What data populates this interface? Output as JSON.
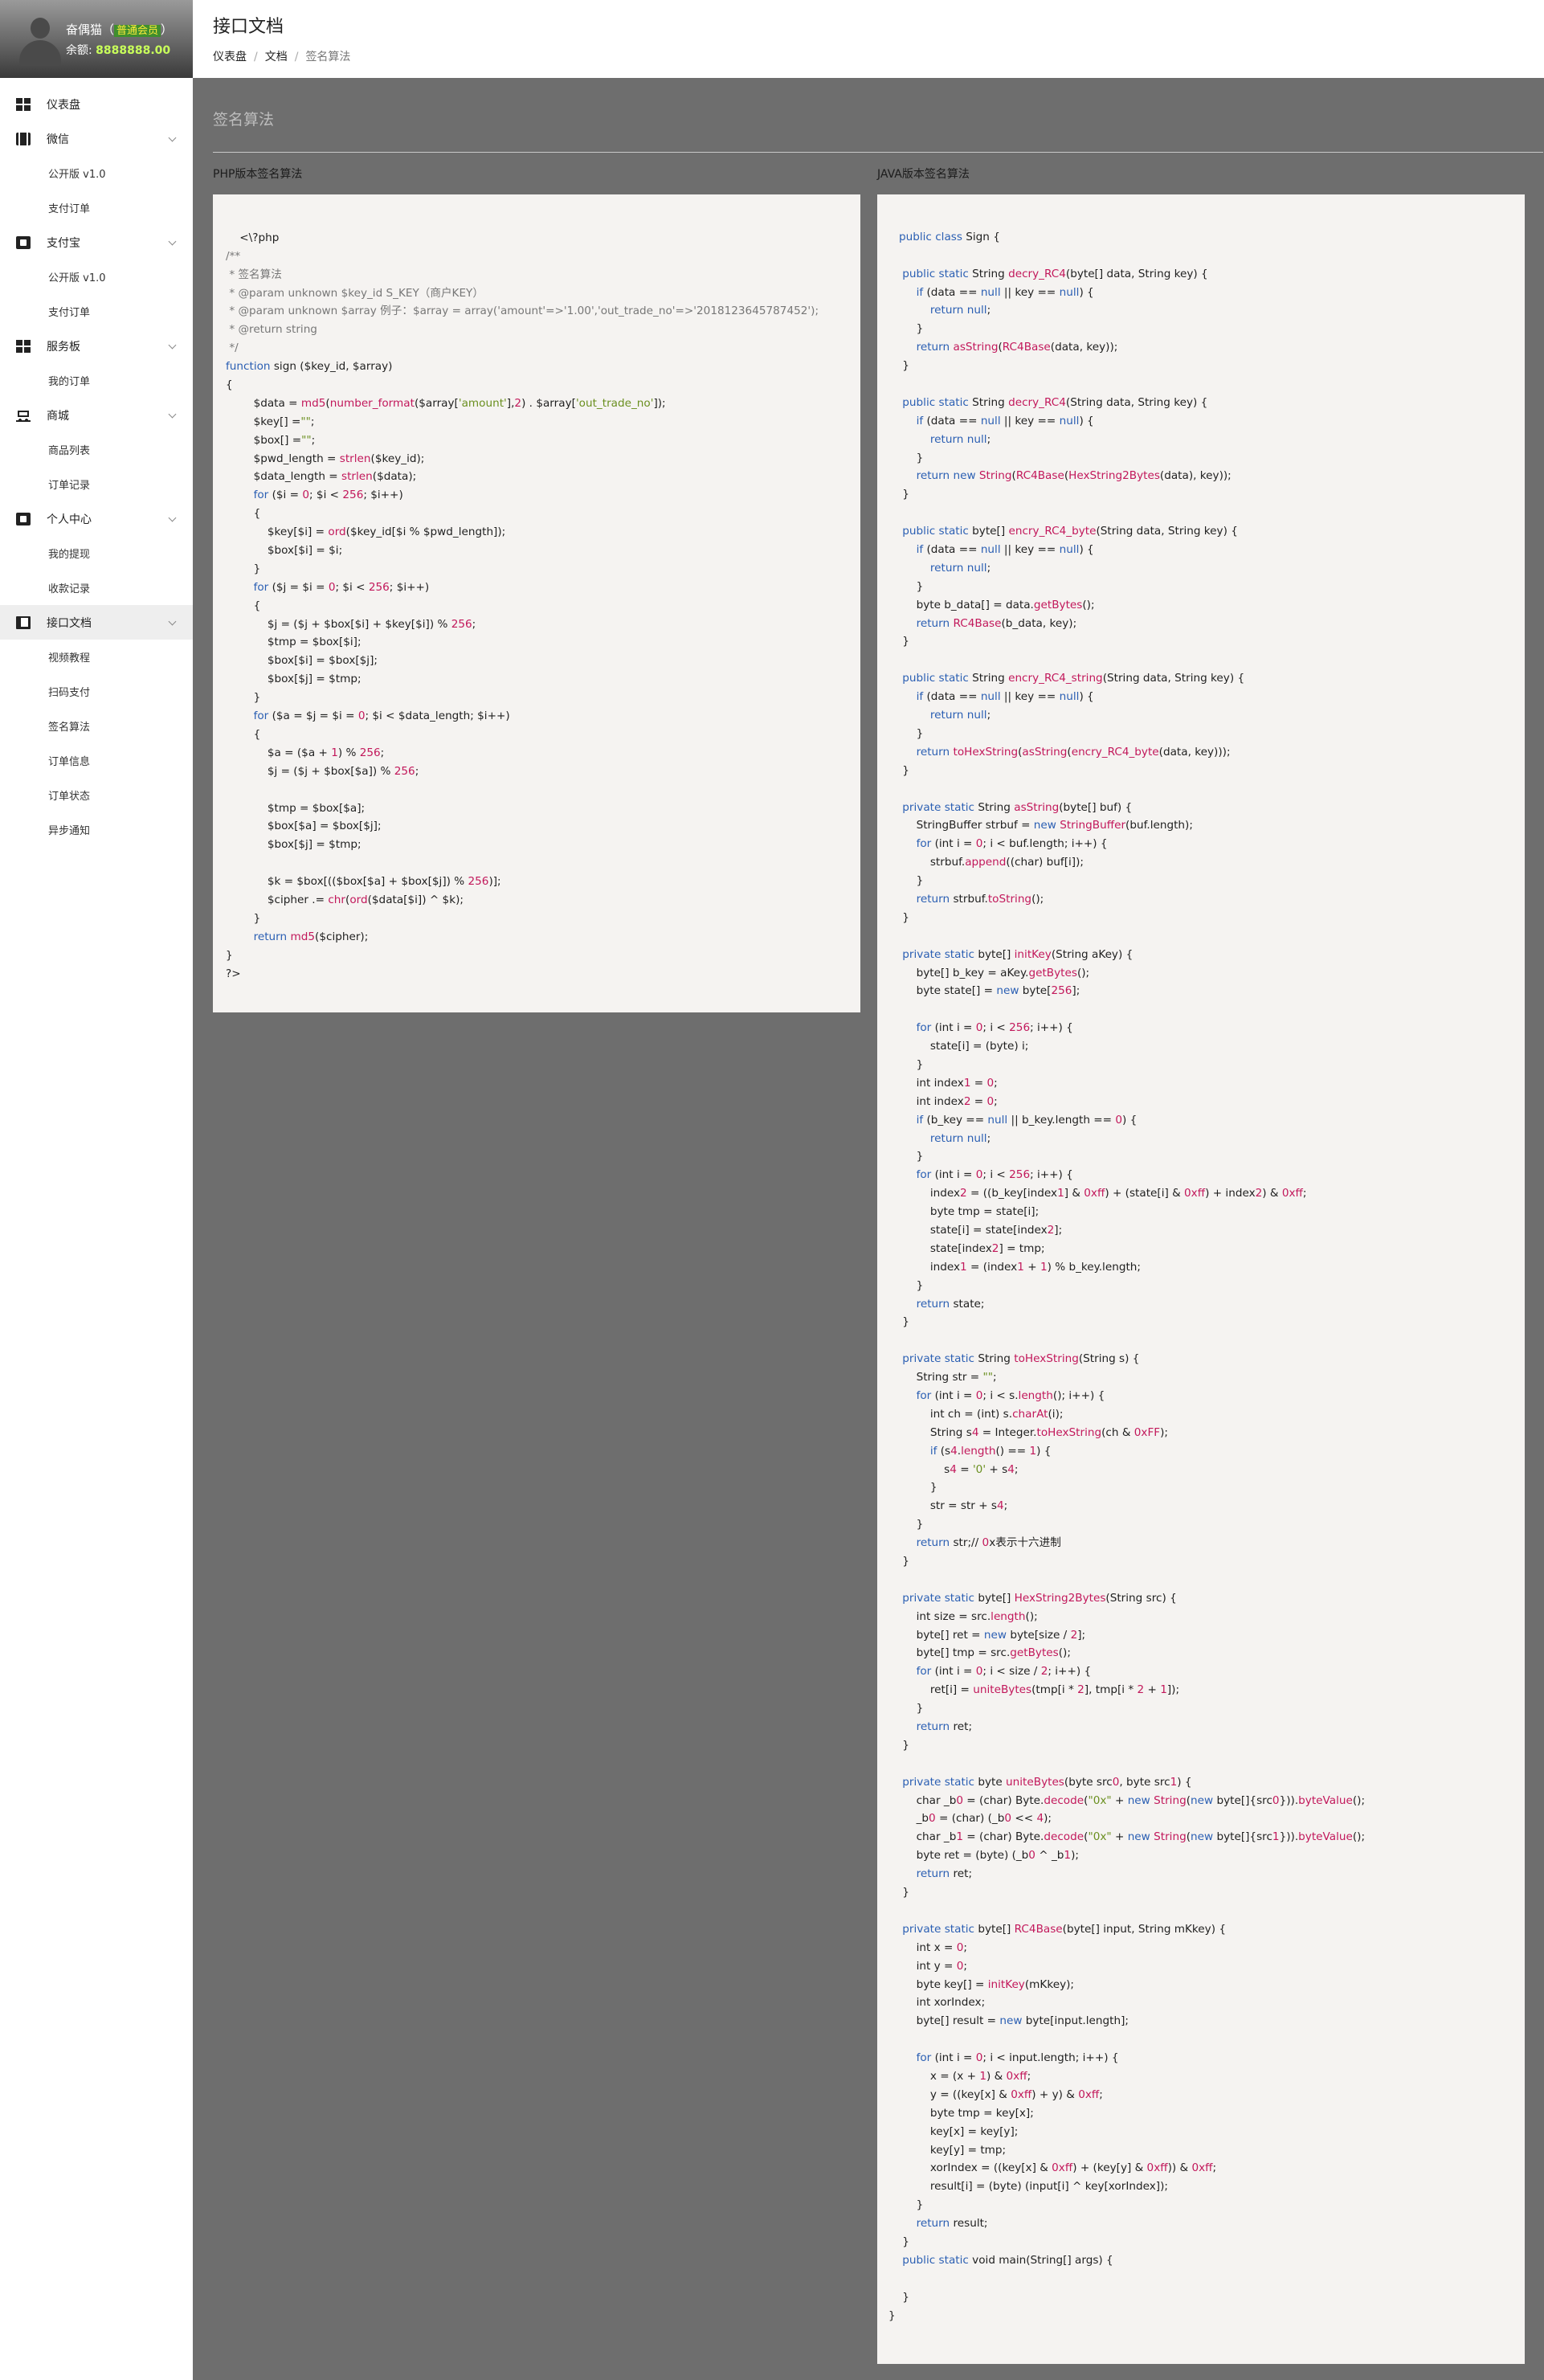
{
  "user": {
    "name": "奋偶猫",
    "open_paren": "（",
    "level": "普通会员",
    "close_paren": "）",
    "balance_label": "余额:",
    "balance": "8888888.00"
  },
  "nav": {
    "dashboard": "仪表盘",
    "wechat": "微信",
    "wechat_items": [
      "公开版 v1.0",
      "支付订单"
    ],
    "alipay": "支付宝",
    "alipay_items": [
      "公开版 v1.0",
      "支付订单"
    ],
    "service": "服务板",
    "service_items": [
      "我的订单"
    ],
    "shop": "商城",
    "shop_items": [
      "商品列表",
      "订单记录"
    ],
    "personal": "个人中心",
    "personal_items": [
      "我的提现",
      "收款记录"
    ],
    "api_docs": "接口文档",
    "api_items": [
      "视频教程",
      "扫码支付",
      "签名算法",
      "订单信息",
      "订单状态",
      "异步通知"
    ]
  },
  "header": {
    "title": "接口文档",
    "breadcrumb": [
      "仪表盘",
      "文档",
      "签名算法"
    ],
    "separator": "/"
  },
  "main": {
    "section_title": "签名算法",
    "php_label": "PHP版本签名算法",
    "java_label": "JAVA版本签名算法"
  },
  "colors": {
    "page_background": "#6e6e6e",
    "code_background": "#f5f3f1",
    "keyword": "#2b5fb3",
    "function": "#c2185b",
    "number": "#c2185b",
    "string": "#6a8f1f",
    "comment": "#777777",
    "balance": "#c8ff5a"
  },
  "php_code": [
    "",
    "    <\\?php",
    "/**",
    " * 签名算法",
    " * @param unknown $key_id S_KEY（商户KEY）",
    " * @param unknown $array 例子：$array = array('amount'=>'1.00','out_trade_no'=>'2018123645787452');",
    " * @return string",
    " */",
    "function sign ($key_id, $array)",
    "{",
    "        $data = md5(number_format($array['amount'],2) . $array['out_trade_no']);",
    "        $key[] =\"\";",
    "        $box[] =\"\";",
    "        $pwd_length = strlen($key_id);",
    "        $data_length = strlen($data);",
    "        for ($i = 0; $i < 256; $i++)",
    "        {",
    "            $key[$i] = ord($key_id[$i % $pwd_length]);",
    "            $box[$i] = $i;",
    "        }",
    "        for ($j = $i = 0; $i < 256; $i++)",
    "        {",
    "            $j = ($j + $box[$i] + $key[$i]) % 256;",
    "            $tmp = $box[$i];",
    "            $box[$i] = $box[$j];",
    "            $box[$j] = $tmp;",
    "        }",
    "        for ($a = $j = $i = 0; $i < $data_length; $i++)",
    "        {",
    "            $a = ($a + 1) % 256;",
    "            $j = ($j + $box[$a]) % 256;",
    "",
    "            $tmp = $box[$a];",
    "            $box[$a] = $box[$j];",
    "            $box[$j] = $tmp;",
    "",
    "            $k = $box[(($box[$a] + $box[$j]) % 256)];",
    "            $cipher .= chr(ord($data[$i]) ^ $k);",
    "        }",
    "        return md5($cipher);",
    "}",
    "?>"
  ],
  "java_code": [
    "",
    "   public class Sign {",
    "",
    "    public static String decry_RC4(byte[] data, String key) {",
    "        if (data == null || key == null) {",
    "            return null;",
    "        }",
    "        return asString(RC4Base(data, key));",
    "    }",
    "",
    "    public static String decry_RC4(String data, String key) {",
    "        if (data == null || key == null) {",
    "            return null;",
    "        }",
    "        return new String(RC4Base(HexString2Bytes(data), key));",
    "    }",
    "",
    "    public static byte[] encry_RC4_byte(String data, String key) {",
    "        if (data == null || key == null) {",
    "            return null;",
    "        }",
    "        byte b_data[] = data.getBytes();",
    "        return RC4Base(b_data, key);",
    "    }",
    "",
    "    public static String encry_RC4_string(String data, String key) {",
    "        if (data == null || key == null) {",
    "            return null;",
    "        }",
    "        return toHexString(asString(encry_RC4_byte(data, key)));",
    "    }",
    "",
    "    private static String asString(byte[] buf) {",
    "        StringBuffer strbuf = new StringBuffer(buf.length);",
    "        for (int i = 0; i < buf.length; i++) {",
    "            strbuf.append((char) buf[i]);",
    "        }",
    "        return strbuf.toString();",
    "    }",
    "",
    "    private static byte[] initKey(String aKey) {",
    "        byte[] b_key = aKey.getBytes();",
    "        byte state[] = new byte[256];",
    "",
    "        for (int i = 0; i < 256; i++) {",
    "            state[i] = (byte) i;",
    "        }",
    "        int index1 = 0;",
    "        int index2 = 0;",
    "        if (b_key == null || b_key.length == 0) {",
    "            return null;",
    "        }",
    "        for (int i = 0; i < 256; i++) {",
    "            index2 = ((b_key[index1] & 0xff) + (state[i] & 0xff) + index2) & 0xff;",
    "            byte tmp = state[i];",
    "            state[i] = state[index2];",
    "            state[index2] = tmp;",
    "            index1 = (index1 + 1) % b_key.length;",
    "        }",
    "        return state;",
    "    }",
    "",
    "    private static String toHexString(String s) {",
    "        String str = \"\";",
    "        for (int i = 0; i < s.length(); i++) {",
    "            int ch = (int) s.charAt(i);",
    "            String s4 = Integer.toHexString(ch & 0xFF);",
    "            if (s4.length() == 1) {",
    "                s4 = '0' + s4;",
    "            }",
    "            str = str + s4;",
    "        }",
    "        return str;// 0x表示十六进制",
    "    }",
    "",
    "    private static byte[] HexString2Bytes(String src) {",
    "        int size = src.length();",
    "        byte[] ret = new byte[size / 2];",
    "        byte[] tmp = src.getBytes();",
    "        for (int i = 0; i < size / 2; i++) {",
    "            ret[i] = uniteBytes(tmp[i * 2], tmp[i * 2 + 1]);",
    "        }",
    "        return ret;",
    "    }",
    "",
    "    private static byte uniteBytes(byte src0, byte src1) {",
    "        char _b0 = (char) Byte.decode(\"0x\" + new String(new byte[]{src0})).byteValue();",
    "        _b0 = (char) (_b0 << 4);",
    "        char _b1 = (char) Byte.decode(\"0x\" + new String(new byte[]{src1})).byteValue();",
    "        byte ret = (byte) (_b0 ^ _b1);",
    "        return ret;",
    "    }",
    "",
    "    private static byte[] RC4Base(byte[] input, String mKkey) {",
    "        int x = 0;",
    "        int y = 0;",
    "        byte key[] = initKey(mKkey);",
    "        int xorIndex;",
    "        byte[] result = new byte[input.length];",
    "",
    "        for (int i = 0; i < input.length; i++) {",
    "            x = (x + 1) & 0xff;",
    "            y = ((key[x] & 0xff) + y) & 0xff;",
    "            byte tmp = key[x];",
    "            key[x] = key[y];",
    "            key[y] = tmp;",
    "            xorIndex = ((key[x] & 0xff) + (key[y] & 0xff)) & 0xff;",
    "            result[i] = (byte) (input[i] ^ key[xorIndex]);",
    "        }",
    "        return result;",
    "    }",
    "    public static void main(String[] args) {",
    "",
    "    }",
    "}"
  ]
}
